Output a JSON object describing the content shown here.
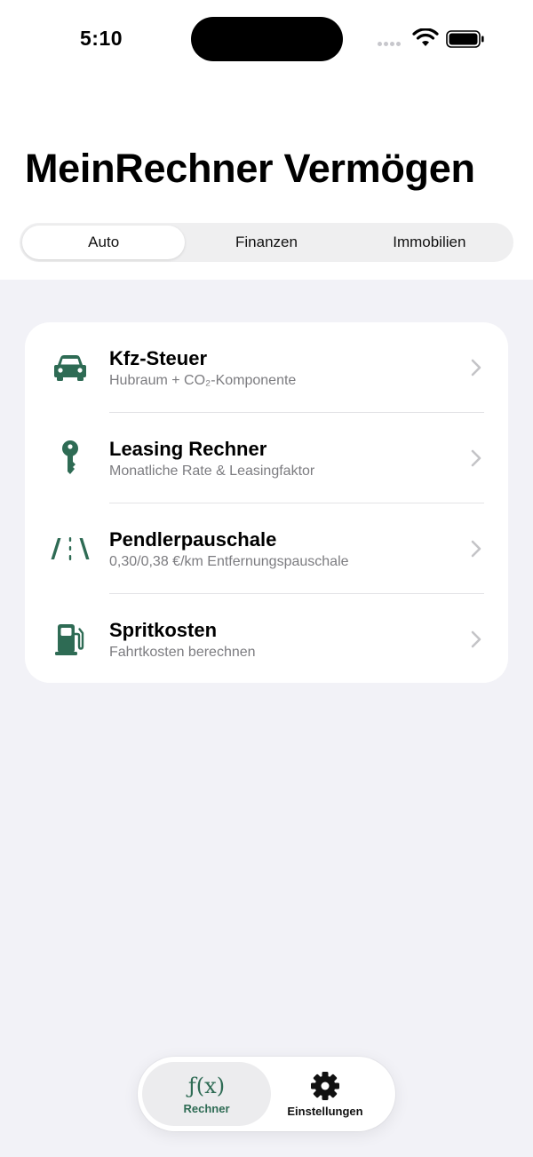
{
  "status_bar": {
    "time": "5:10"
  },
  "header": {
    "title": "MeinRechner Vermögen"
  },
  "segmented_control": {
    "segments": [
      {
        "label": "Auto",
        "selected": true
      },
      {
        "label": "Finanzen",
        "selected": false
      },
      {
        "label": "Immobilien",
        "selected": false
      }
    ]
  },
  "calculators": [
    {
      "icon": "car-icon",
      "title": "Kfz-Steuer",
      "subtitle": "Hubraum + CO₂-Komponente"
    },
    {
      "icon": "key-icon",
      "title": "Leasing Rechner",
      "subtitle": "Monatliche Rate & Leasingfaktor"
    },
    {
      "icon": "road-icon",
      "title": "Pendlerpauschale",
      "subtitle": "0,30/0,38 €/km Entfernungspauschale"
    },
    {
      "icon": "fuel-pump-icon",
      "title": "Spritkosten",
      "subtitle": "Fahrtkosten berechnen"
    }
  ],
  "tab_bar": {
    "tabs": [
      {
        "icon": "function-icon",
        "icon_text": "ƒ(x)",
        "label": "Rechner",
        "selected": true
      },
      {
        "icon": "gear-icon",
        "label": "Einstellungen",
        "selected": false
      }
    ]
  },
  "colors": {
    "accent": "#2e6b54",
    "background": "#f2f2f7",
    "card": "#ffffff",
    "secondary_text": "#7c7c80"
  }
}
